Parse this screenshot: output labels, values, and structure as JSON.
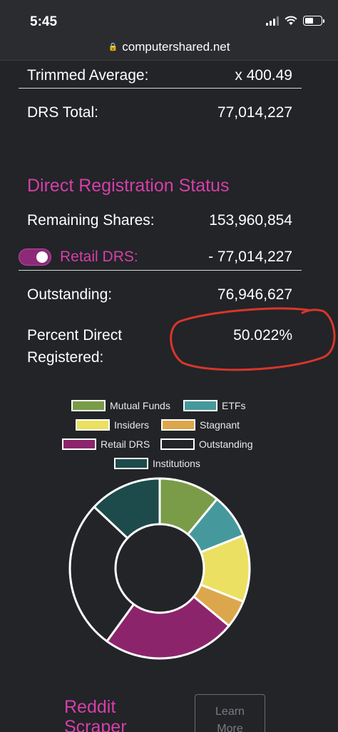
{
  "status_bar": {
    "time": "5:45"
  },
  "browser": {
    "url": "computershared.net"
  },
  "stats": {
    "trimmed_average_label": "Trimmed Average:",
    "trimmed_average_value": "x 400.49",
    "drs_total_label": "DRS Total:",
    "drs_total_value": "77,014,227"
  },
  "registration": {
    "title": "Direct Registration Status",
    "remaining_label": "Remaining Shares:",
    "remaining_value": "153,960,854",
    "retail_label": "Retail DRS:",
    "retail_value": "- 77,014,227",
    "retail_toggle_on": true,
    "outstanding_label": "Outstanding:",
    "outstanding_value": "76,946,627",
    "percent_label_line1": "Percent Direct",
    "percent_label_line2": "Registered:",
    "percent_value": "50.022%"
  },
  "chart_data": {
    "type": "pie",
    "legend": [
      {
        "name": "Mutual Funds",
        "color": "#7a9c48"
      },
      {
        "name": "ETFs",
        "color": "#45999c"
      },
      {
        "name": "Insiders",
        "color": "#ece062"
      },
      {
        "name": "Stagnant",
        "color": "#dca74c"
      },
      {
        "name": "Retail DRS",
        "color": "#8c246c"
      },
      {
        "name": "Outstanding",
        "color": "#232428"
      },
      {
        "name": "Institutions",
        "color": "#1d4a4a"
      }
    ],
    "slices": [
      {
        "name": "Mutual Funds",
        "value": 11
      },
      {
        "name": "ETFs",
        "value": 8
      },
      {
        "name": "Insiders",
        "value": 12
      },
      {
        "name": "Stagnant",
        "value": 5
      },
      {
        "name": "Retail DRS",
        "value": 24
      },
      {
        "name": "Outstanding",
        "value": 27
      },
      {
        "name": "Institutions",
        "value": 13
      }
    ]
  },
  "footer": {
    "reddit_line1": "Reddit",
    "reddit_line2": "Scraper",
    "learn_line1": "Learn",
    "learn_line2": "More"
  }
}
